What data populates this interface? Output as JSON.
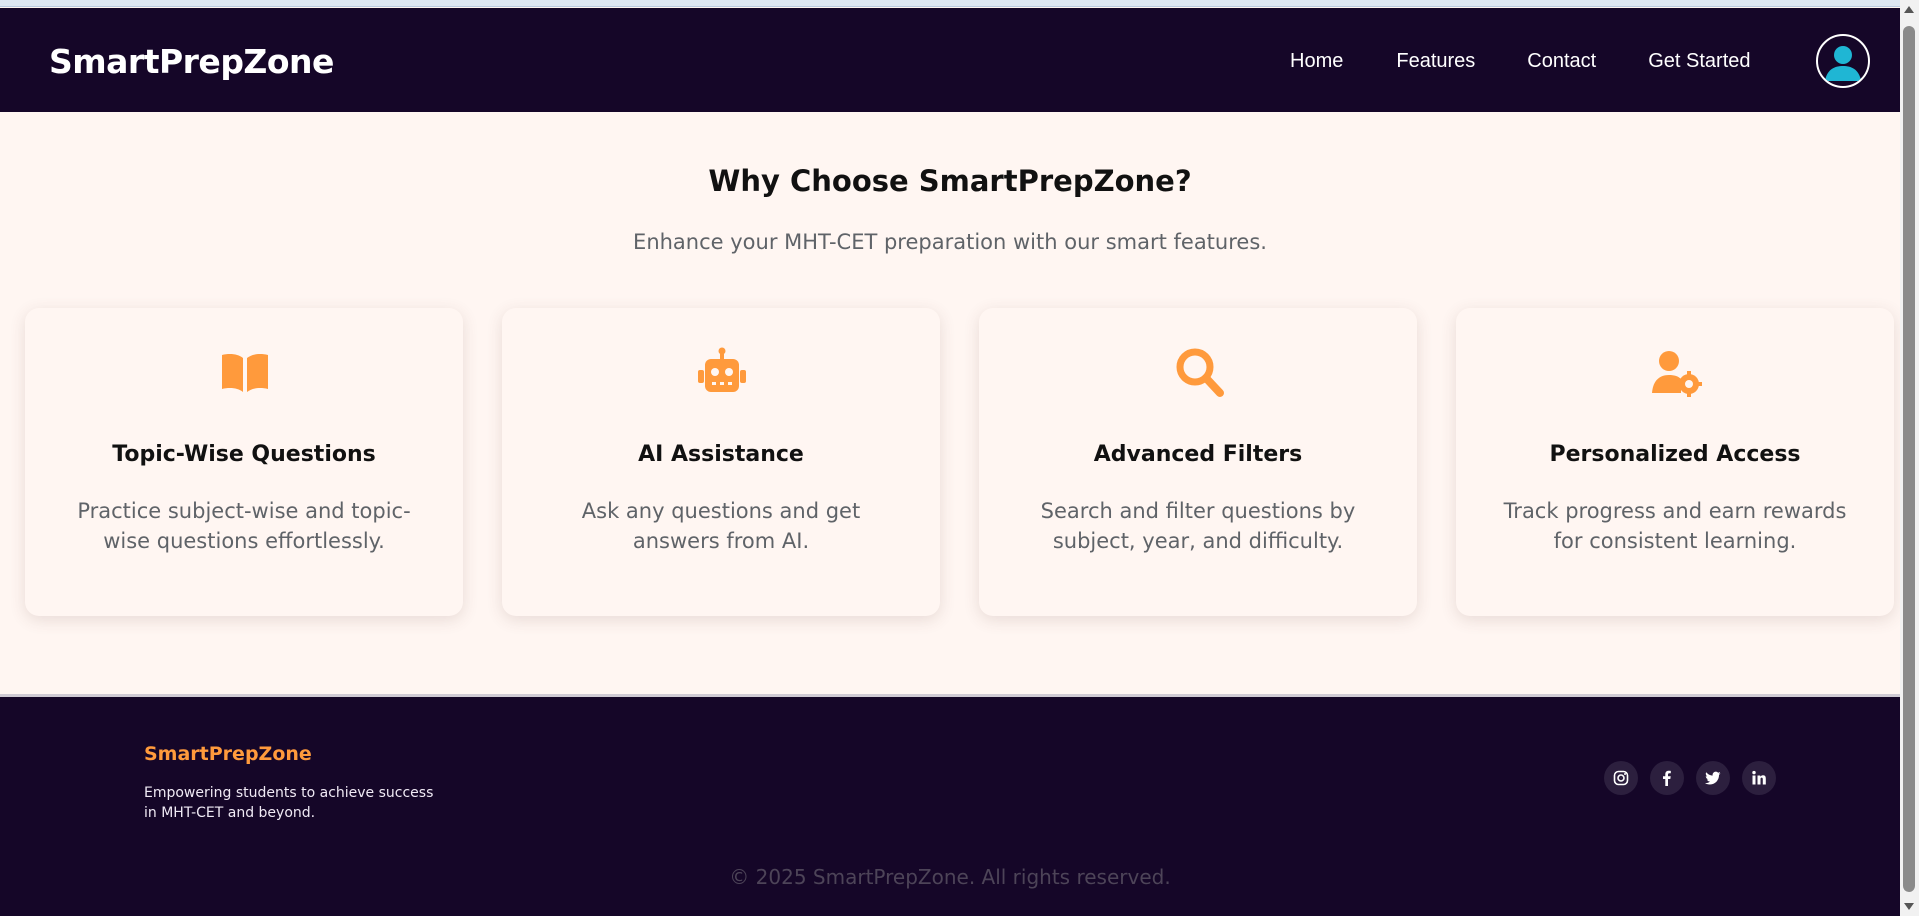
{
  "header": {
    "brand": "SmartPrepZone",
    "nav": [
      "Home",
      "Features",
      "Contact",
      "Get Started"
    ],
    "avatar_icon": "user-avatar-icon"
  },
  "features": {
    "title": "Why Choose SmartPrepZone?",
    "subtitle": "Enhance your MHT-CET preparation with our smart features.",
    "accent": "#ff9a3c",
    "cards": [
      {
        "icon": "book-open-icon",
        "title": "Topic-Wise Questions",
        "desc": "Practice subject-wise and topic-wise questions effortlessly."
      },
      {
        "icon": "robot-icon",
        "title": "AI Assistance",
        "desc": "Ask any questions and get answers from AI."
      },
      {
        "icon": "search-icon",
        "title": "Advanced Filters",
        "desc": "Search and filter questions by subject, year, and difficulty."
      },
      {
        "icon": "user-gear-icon",
        "title": "Personalized Access",
        "desc": "Track progress and earn rewards for consistent learning."
      }
    ]
  },
  "footer": {
    "brand": "SmartPrepZone",
    "tagline": "Empowering students to achieve success in MHT-CET and beyond.",
    "socials": [
      "instagram-icon",
      "facebook-icon",
      "twitter-icon",
      "linkedin-icon"
    ],
    "copyright": "© 2025 SmartPrepZone. All rights reserved."
  },
  "colors": {
    "navbar_bg": "#150628",
    "page_bg": "#fff6f2",
    "accent": "#ff9a3c",
    "avatar": "#1fb6d4"
  }
}
